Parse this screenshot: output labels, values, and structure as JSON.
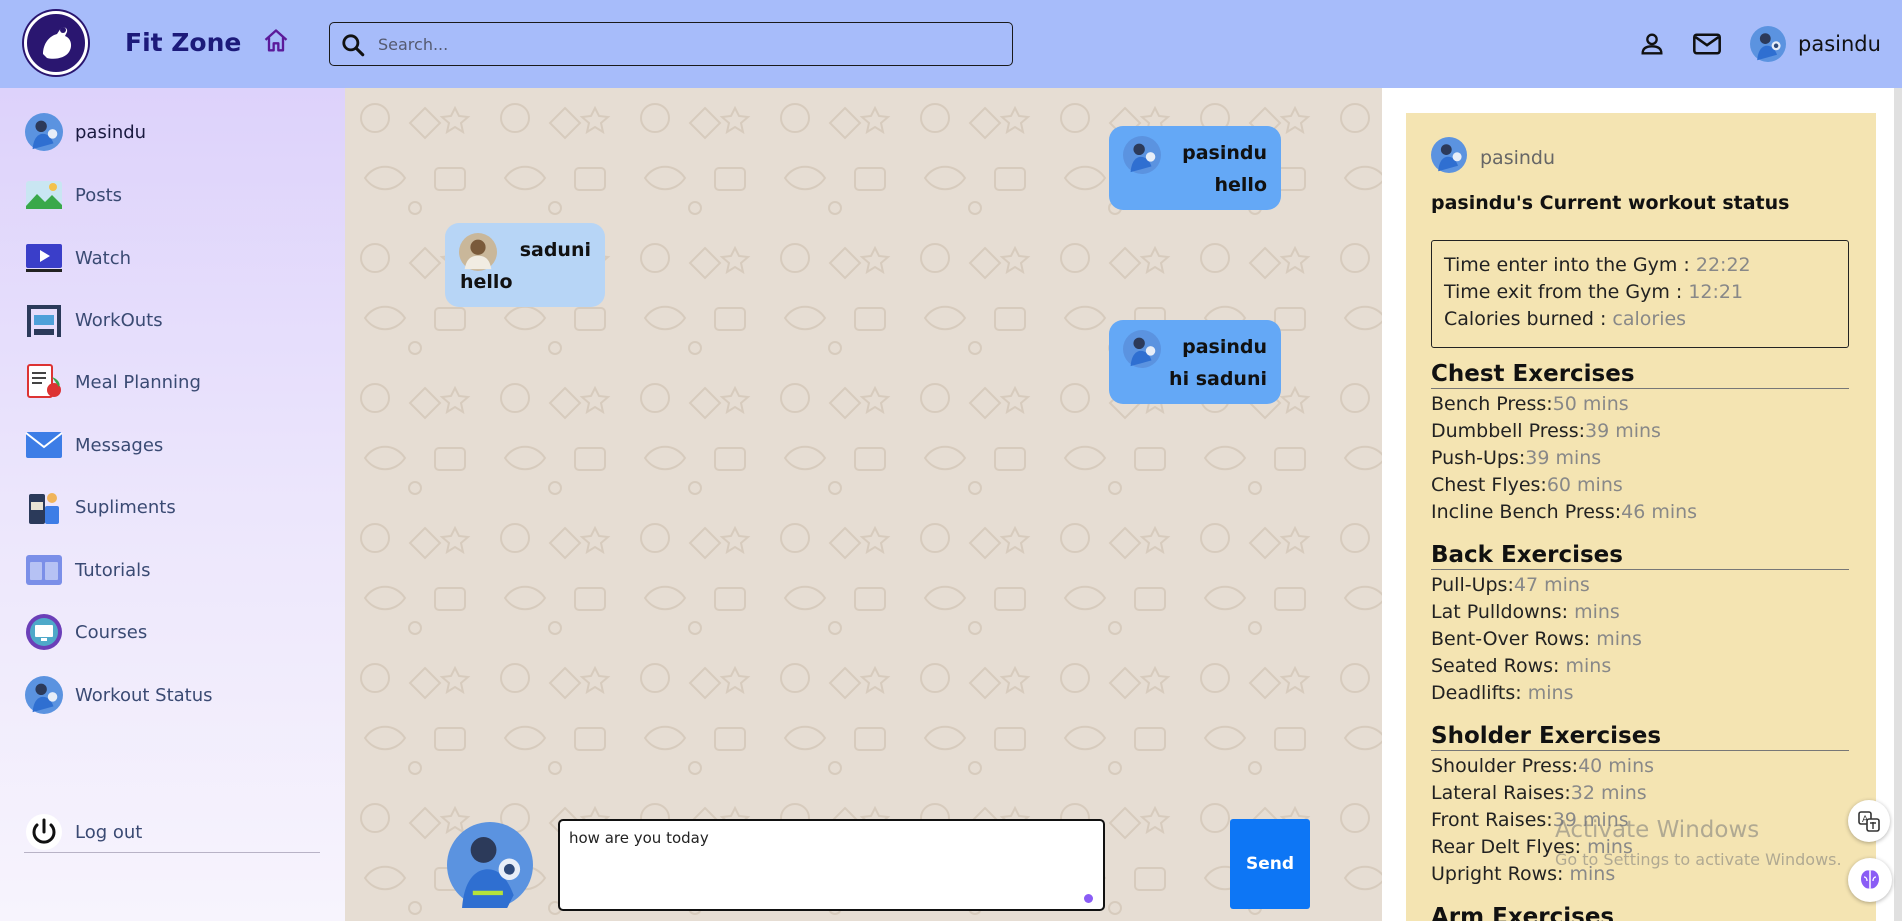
{
  "header": {
    "brand": "Fit Zone",
    "search_placeholder": "Search...",
    "username": "pasindu"
  },
  "sidebar": {
    "items": [
      {
        "label": "pasindu",
        "icon": "user-avatar-icon"
      },
      {
        "label": "Posts",
        "icon": "image-icon"
      },
      {
        "label": "Watch",
        "icon": "video-icon"
      },
      {
        "label": "WorkOuts",
        "icon": "gym-icon"
      },
      {
        "label": "Meal Planning",
        "icon": "diet-icon"
      },
      {
        "label": "Messages",
        "icon": "envelope-icon"
      },
      {
        "label": "Supliments",
        "icon": "supplement-icon"
      },
      {
        "label": "Tutorials",
        "icon": "tutorial-icon"
      },
      {
        "label": "Courses",
        "icon": "courses-icon"
      },
      {
        "label": "Workout Status",
        "icon": "workout-status-icon"
      }
    ],
    "logout": "Log out"
  },
  "chat": {
    "messages": [
      {
        "sender": "pasindu",
        "text": "hello",
        "mine": true
      },
      {
        "sender": "saduni",
        "text": "hello",
        "mine": false
      },
      {
        "sender": "pasindu",
        "text": "hi saduni",
        "mine": true
      }
    ],
    "composer_value": "how are you today",
    "send_label": "Send"
  },
  "status": {
    "username": "pasindu",
    "title": "pasindu's Current workout status",
    "enter_label": "Time enter into the Gym : ",
    "enter_value": "22:22",
    "exit_label": "Time exit from the Gym : ",
    "exit_value": "12:21",
    "calories_label": "Calories burned : ",
    "calories_value": "calories",
    "sections": [
      {
        "title": "Chest Exercises",
        "rows": [
          {
            "name": "Bench Press:",
            "value": "50 mins"
          },
          {
            "name": "Dumbbell Press:",
            "value": "39 mins"
          },
          {
            "name": "Push-Ups:",
            "value": "39 mins"
          },
          {
            "name": "Chest Flyes:",
            "value": "60 mins"
          },
          {
            "name": "Incline Bench Press:",
            "value": "46 mins"
          }
        ]
      },
      {
        "title": "Back Exercises",
        "rows": [
          {
            "name": "Pull-Ups:",
            "value": "47 mins"
          },
          {
            "name": "Lat Pulldowns: ",
            "value": "mins"
          },
          {
            "name": "Bent-Over Rows: ",
            "value": "mins"
          },
          {
            "name": "Seated Rows: ",
            "value": "mins"
          },
          {
            "name": "Deadlifts: ",
            "value": "mins"
          }
        ]
      },
      {
        "title": "Sholder Exercises",
        "rows": [
          {
            "name": "Shoulder Press:",
            "value": "40 mins"
          },
          {
            "name": "Lateral Raises:",
            "value": "32 mins"
          },
          {
            "name": "Front Raises:",
            "value": "39 mins"
          },
          {
            "name": "Rear Delt Flyes: ",
            "value": "mins"
          },
          {
            "name": "Upright Rows: ",
            "value": "mins"
          }
        ]
      },
      {
        "title": "Arm Exercises",
        "rows": []
      }
    ]
  },
  "watermark": {
    "line1": "Activate Windows",
    "line2": "Go to Settings to activate Windows."
  }
}
